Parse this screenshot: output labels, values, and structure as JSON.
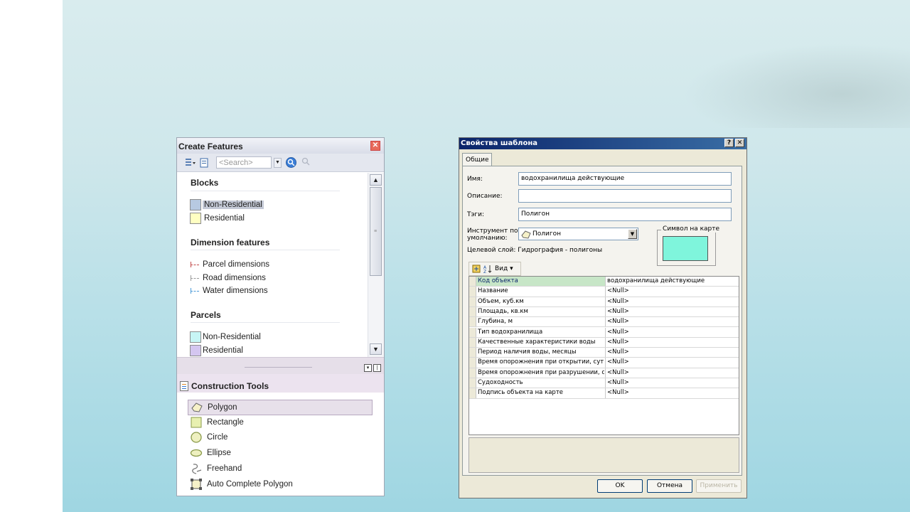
{
  "create_features": {
    "title": "Create Features",
    "close_glyph": "✕",
    "search_placeholder": "<Search>",
    "groups": [
      {
        "title": "Blocks",
        "items": [
          {
            "label": "Non-Residential",
            "swatch": "#b7c9e1",
            "selected": true
          },
          {
            "label": "Residential",
            "swatch": "#ffffc2"
          }
        ]
      },
      {
        "title": "Dimension features",
        "items": [
          {
            "label": "Parcel dimensions",
            "icon": "dimension-icon",
            "color": "#c24a4a"
          },
          {
            "label": "Road dimensions",
            "icon": "dimension-icon",
            "color": "#9a9a9a"
          },
          {
            "label": "Water dimensions",
            "icon": "dimension-icon",
            "color": "#4a9ad8"
          }
        ]
      },
      {
        "title": "Parcels",
        "items": [
          {
            "label": "Non-Residential",
            "swatch": "#c7f5f5"
          },
          {
            "label": "Residential",
            "swatch": "#d4c6f0"
          }
        ]
      }
    ],
    "construction_tools": {
      "title": "Construction Tools",
      "items": [
        {
          "label": "Polygon",
          "icon": "polygon-icon",
          "selected": true
        },
        {
          "label": "Rectangle",
          "icon": "rectangle-icon"
        },
        {
          "label": "Circle",
          "icon": "circle-icon"
        },
        {
          "label": "Ellipse",
          "icon": "ellipse-icon"
        },
        {
          "label": "Freehand",
          "icon": "freehand-icon"
        },
        {
          "label": "Auto Complete Polygon",
          "icon": "auto-complete-polygon-icon"
        }
      ]
    }
  },
  "template_dialog": {
    "title": "Свойства шаблона",
    "help_glyph": "?",
    "close_glyph": "✕",
    "tab": "Общие",
    "name_label": "Имя:",
    "name_value": "водохранилища действующие",
    "description_label": "Описание:",
    "description_value": "",
    "tags_label": "Тэги:",
    "tags_value": "Полигон",
    "default_tool_label_line1": "Инструмент по",
    "default_tool_label_line2": "умолчанию:",
    "default_tool_value": "Полигон",
    "target_layer_text": "Целевой слой: Гидрография - полигоны",
    "map_symbol_label": "Символ на карте",
    "symbol_color": "#7ff5dc",
    "grid_view_label": "Вид",
    "attributes": [
      {
        "field": "Код объекта",
        "value": "водохранилища действующие"
      },
      {
        "field": "Название",
        "value": "<Null>"
      },
      {
        "field": "Объем, куб.км",
        "value": "<Null>"
      },
      {
        "field": "Площадь, кв.км",
        "value": "<Null>"
      },
      {
        "field": "Глубина, м",
        "value": "<Null>"
      },
      {
        "field": "Тип водохранилища",
        "value": "<Null>"
      },
      {
        "field": "Качественные характеристики воды",
        "value": "<Null>"
      },
      {
        "field": "Период наличия воды, месяцы",
        "value": "<Null>"
      },
      {
        "field": "Время опорожнения при открытии, сутки",
        "value": "<Null>"
      },
      {
        "field": "Время опорожнения при разрушении, сутки",
        "value": "<Null>"
      },
      {
        "field": "Судоходность",
        "value": "<Null>"
      },
      {
        "field": "Подпись объекта на карте",
        "value": "<Null>"
      }
    ],
    "ok_label": "OK",
    "cancel_label": "Отмена",
    "apply_label": "Применить"
  }
}
